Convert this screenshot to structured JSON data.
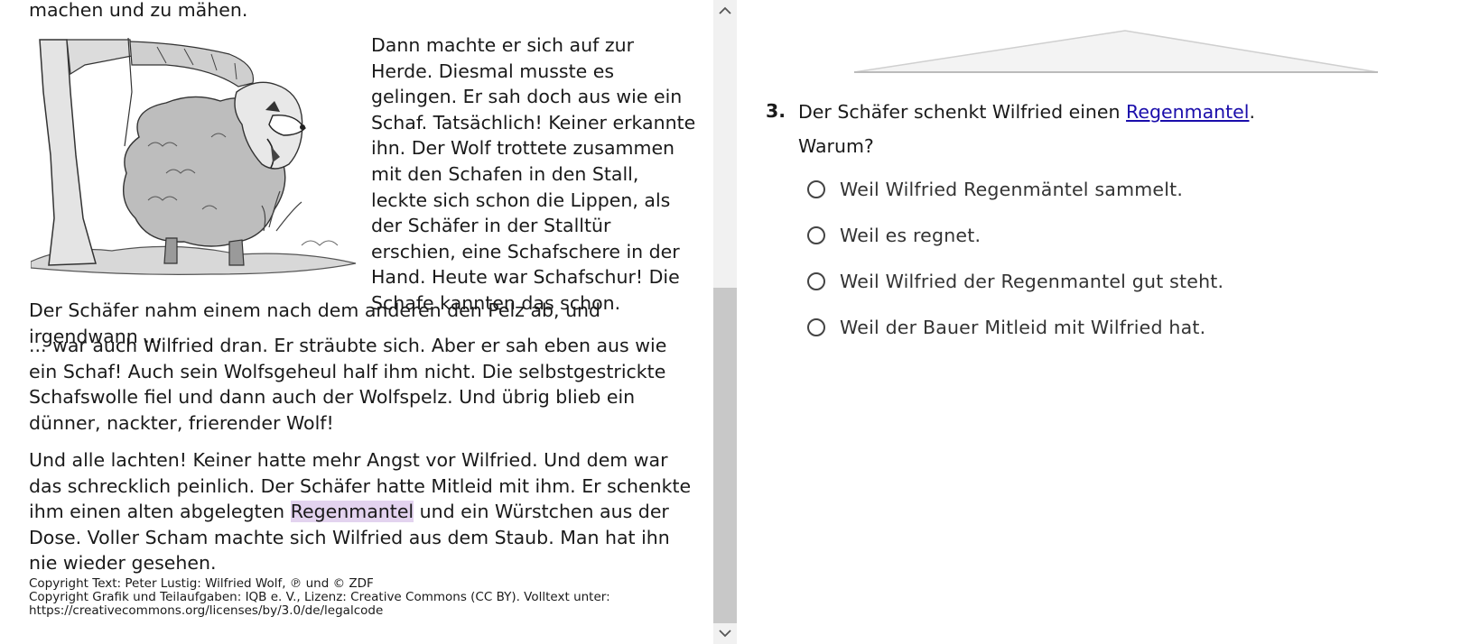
{
  "story": {
    "top_line": "machen und zu mähen.",
    "wrap_text": "Dann machte er sich auf zur Herde. Diesmal musste es gelingen. Er sah doch aus wie ein Schaf. Tatsächlich! Keiner erkannte ihn. Der Wolf trottete zusammen mit den Schafen in den Stall, leckte sich schon die Lippen, als der Schäfer in der Stalltür erschien, eine Schafschere in der Hand. Heute war Schafschur! Die Schafe kannten das schon.",
    "mid_line": "Der Schäfer nahm einem nach dem anderen den Pelz ab, und irgendwann ...",
    "para_dran": "... war auch Wilfried dran. Er sträubte sich. Aber er sah eben aus wie ein Schaf! Auch sein Wolfsgeheul half ihm nicht. Die selbstgestrickte Schafswolle fiel und dann auch der Wolfspelz. Und übrig blieb ein dünner, nackter, frierender Wolf!",
    "last_before": "Und alle lachten! Keiner hatte mehr Angst vor Wilfried. Und dem war das schrecklich peinlich. Der Schäfer hatte Mitleid mit ihm. Er schenkte ihm einen alten abgelegten ",
    "last_highlight": "Regenmantel",
    "last_after": " und ein Würstchen aus der Dose. Voller Scham machte sich Wilfried aus dem Staub. Man hat ihn nie wieder gesehen."
  },
  "copyright": {
    "line1": "Copyright Text: Peter Lustig: Wilfried Wolf, ℗ und © ZDF",
    "line2": "Copyright Grafik und Teilaufgaben: IQB e. V., Lizenz: Creative Commons (CC BY). Volltext unter: https://creativecommons.org/licenses/by/3.0/de/legalcode"
  },
  "scrollbar": {
    "up_icon": "chevron-up-icon",
    "down_icon": "chevron-down-icon"
  },
  "question": {
    "number": "3.",
    "text_before": "Der Schäfer schenkt Wilfried einen ",
    "link_text": "Regenmantel",
    "text_after": ".",
    "sub": "Warum?",
    "options": [
      "Weil Wilfried Regenmäntel sammelt.",
      "Weil es regnet.",
      "Weil Wilfried der Regenmantel gut steht.",
      "Weil der Bauer Mitleid mit Wilfried hat."
    ]
  },
  "colors": {
    "highlight": "#e3d3ef",
    "link": "#1a0dab",
    "scroll_thumb": "#c8c8c8"
  }
}
